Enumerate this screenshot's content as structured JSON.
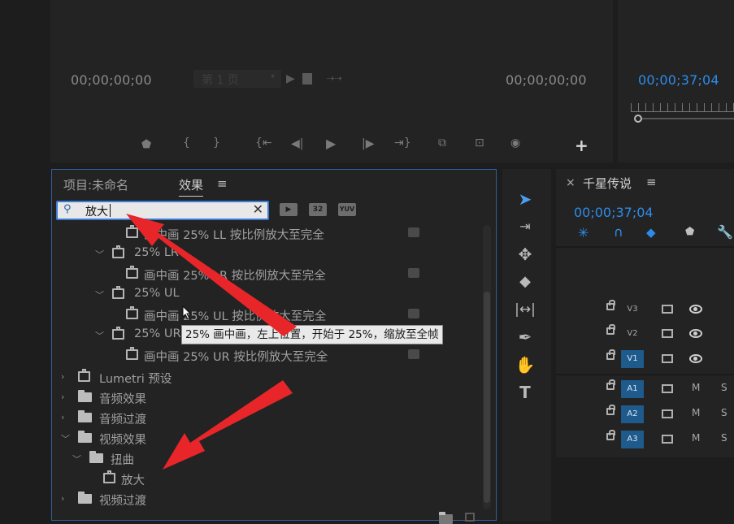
{
  "source_monitor": {
    "timecode_left": "00;00;00;00",
    "timecode_right": "00;00;00;00",
    "page_select": "第 1 页"
  },
  "program_monitor": {
    "timecode": "00;00;37;04"
  },
  "effects_panel": {
    "tab_project": "项目:未命名",
    "tab_effects": "效果",
    "menu_glyph": "≡",
    "search": {
      "value": "放大",
      "placeholder": ""
    },
    "preset_buttons": [
      "accelerated-effects",
      "32-bit",
      "YUV"
    ],
    "preset_32": "32",
    "preset_yuv": "YUV",
    "tree": [
      {
        "label": "画中画 25% LL 按比例放大至完全",
        "type": "effect"
      },
      {
        "label": "25% LR",
        "type": "folder"
      },
      {
        "label": "画中画 25% LR 按比例放大至完全",
        "type": "effect"
      },
      {
        "label": "25% UL",
        "type": "folder"
      },
      {
        "label": "画中画 25% UL 按比例放大至完全",
        "type": "effect"
      },
      {
        "label": "25% UR",
        "type": "folder"
      },
      {
        "label": "画中画 25% UR 按比例放大至完全",
        "type": "effect"
      },
      {
        "label": "Lumetri 预设",
        "type": "folder"
      },
      {
        "label": "音频效果",
        "type": "folder"
      },
      {
        "label": "音频过渡",
        "type": "folder"
      },
      {
        "label": "视频效果",
        "type": "folder"
      },
      {
        "label": "扭曲",
        "type": "folder"
      },
      {
        "label": "放大",
        "type": "effect"
      },
      {
        "label": "视频过渡",
        "type": "folder"
      }
    ],
    "tooltip": "25% 画中画，左上位置，开始于 25%，缩放至全帧"
  },
  "timeline": {
    "close_glyph": "×",
    "sequence_name": "千星传说",
    "menu_glyph": "≡",
    "timecode": "00;00;37;04",
    "tracks": [
      {
        "label": "V3",
        "active": false
      },
      {
        "label": "V2",
        "active": false
      },
      {
        "label": "V1",
        "active": true
      },
      {
        "label": "A1",
        "active": true
      },
      {
        "label": "A2",
        "active": true
      },
      {
        "label": "A3",
        "active": true
      }
    ],
    "mute": "M",
    "solo": "S"
  },
  "tools": [
    "selection-tool",
    "track-select-tool",
    "ripple-edit-tool",
    "razor-tool",
    "slip-tool",
    "pen-tool",
    "hand-tool",
    "type-tool"
  ],
  "colors": {
    "accent": "#2d8ceb",
    "annotation_arrow": "#e8262a",
    "active_track": "#1f5a8c"
  }
}
